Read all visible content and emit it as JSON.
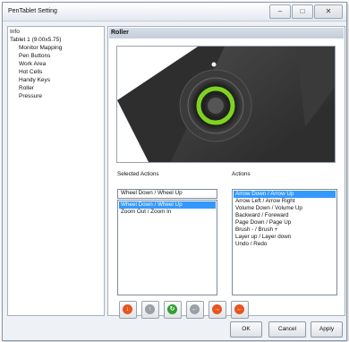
{
  "window": {
    "title": "PenTablet Setting"
  },
  "titlebar_buttons": {
    "minimize": "–",
    "maximize": "□",
    "close": "✕"
  },
  "tree": {
    "items": [
      "Info",
      "Tablet 1 (9.00x5.75)",
      "Monitor Mapping",
      "Pen Buttons",
      "Work Area",
      "Hot Cells",
      "Handy Keys",
      "Roller",
      "Pressure"
    ]
  },
  "panel": {
    "title": "Roller"
  },
  "selected_actions": {
    "label": "Selected Actions",
    "field_value": "Wheel Down / Wheel Up",
    "items": [
      "Wheel Down / Wheel Up",
      "Zoom Out / Zoom In"
    ],
    "selected_index": 0
  },
  "actions": {
    "label": "Actions",
    "items": [
      "Arrow Down / Arrow Up",
      "Arrow Left / Arrow Right",
      "Volume Down / Volume Up",
      "Backward / Foreward",
      "Page Down / Page Up",
      "Brush - / Brush +",
      "Layer up / Layer down",
      "Undo / Redo"
    ],
    "selected_index": 0
  },
  "action_buttons": [
    {
      "name": "move-down-icon",
      "glyph": "↓",
      "color": "#e8551e"
    },
    {
      "name": "move-up-icon",
      "glyph": "↑",
      "color": "#9aa0a6"
    },
    {
      "name": "refresh-icon",
      "glyph": "↻",
      "color": "#2fa02f"
    },
    {
      "name": "remove-icon",
      "glyph": "←",
      "color": "#9aa0a6"
    },
    {
      "name": "add-right-icon",
      "glyph": "→",
      "color": "#e8551e"
    },
    {
      "name": "add-left-icon",
      "glyph": "←",
      "color": "#e8551e"
    }
  ],
  "dialog_buttons": {
    "ok": "OK",
    "cancel": "Cancel",
    "apply": "Apply"
  },
  "colors": {
    "selection": "#3399ff",
    "accent_green": "#7ed321"
  }
}
